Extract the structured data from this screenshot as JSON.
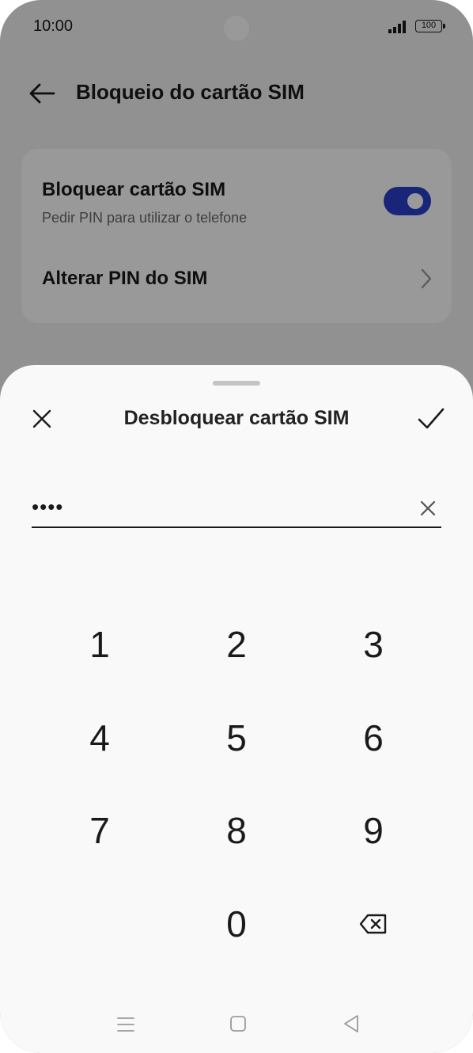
{
  "status_bar": {
    "time": "10:00",
    "battery": "100"
  },
  "header": {
    "title": "Bloqueio do cartão SIM"
  },
  "settings": {
    "lock_sim_title": "Bloquear cartão SIM",
    "lock_sim_subtitle": "Pedir PIN para utilizar o telefone",
    "lock_sim_enabled": true,
    "change_pin_title": "Alterar PIN do SIM"
  },
  "sheet": {
    "title": "Desbloquear cartão SIM",
    "pin_value": "••••"
  },
  "keypad": {
    "keys": [
      "1",
      "2",
      "3",
      "4",
      "5",
      "6",
      "7",
      "8",
      "9",
      "0"
    ]
  },
  "colors": {
    "accent": "#2b3ec8"
  },
  "icons": {
    "back": "arrow-left-icon",
    "close": "close-icon",
    "confirm": "checkmark-icon",
    "clear": "clear-icon",
    "backspace": "backspace-icon",
    "nav_menu": "menu-icon",
    "nav_home": "home-icon",
    "nav_back": "back-triangle-icon"
  }
}
